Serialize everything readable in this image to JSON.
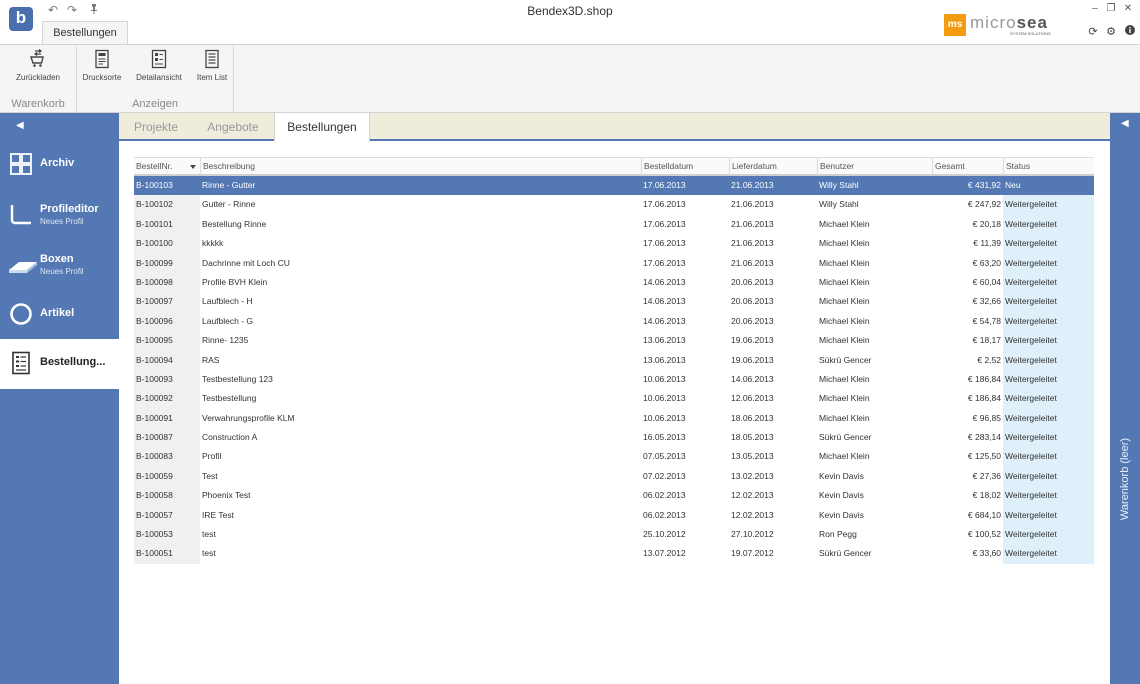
{
  "window": {
    "title": "Bendex3D.shop",
    "logo_letter": "b"
  },
  "quick_access": {
    "undo_icon": "undo-icon",
    "redo_icon": "redo-icon",
    "pin_icon": "pin-icon"
  },
  "ribbon": {
    "active_tab": "Bestellungen",
    "groups": [
      {
        "label": "Warenkorb",
        "buttons": [
          {
            "label": "Zurückladen",
            "icon": "cart-reload-icon"
          }
        ]
      },
      {
        "label": "Anzeigen",
        "buttons": [
          {
            "label": "Drucksorte",
            "icon": "print-document-icon"
          },
          {
            "label": "Detailansicht",
            "icon": "detail-view-icon"
          },
          {
            "label": "Item List",
            "icon": "item-list-icon"
          }
        ]
      }
    ]
  },
  "brand": {
    "mark": "ms",
    "word_light": "micro",
    "word_bold": "sea",
    "tagline": "SYSTEM SOLUTIONS"
  },
  "window_controls": {
    "minimize": "–",
    "restore": "❐",
    "close": "✕"
  },
  "system_icons": [
    "refresh-icon",
    "settings-icon",
    "info-icon"
  ],
  "sidebar": {
    "collapse_glyph": "◀",
    "items": [
      {
        "title": "Archiv",
        "subtitle": "",
        "icon": "archive-grid-icon",
        "active": false
      },
      {
        "title": "Profileditor",
        "subtitle": "Neues Profil",
        "icon": "profile-editor-icon",
        "active": false
      },
      {
        "title": "Boxen",
        "subtitle": "Neues Profil",
        "icon": "box-icon",
        "active": false
      },
      {
        "title": "Artikel",
        "subtitle": "",
        "icon": "article-circle-icon",
        "active": false
      },
      {
        "title": "Bestellung...",
        "subtitle": "",
        "icon": "orders-icon",
        "active": true
      }
    ]
  },
  "right_panel": {
    "expand_glyph": "◀",
    "label": "Warenkorb (leer)"
  },
  "tabs": [
    {
      "label": "Projekte",
      "active": false
    },
    {
      "label": "Angebote",
      "active": false
    },
    {
      "label": "Bestellungen",
      "active": true
    }
  ],
  "table": {
    "columns": [
      "BestellNr.",
      "Beschreibung",
      "Bestelldatum",
      "Lieferdatum",
      "Benutzer",
      "Gesamt",
      "Status"
    ],
    "sorted_column": "BestellNr.",
    "sort_direction": "descending",
    "selected_row": 0,
    "rows": [
      [
        "B-100103",
        "Rinne - Gutter",
        "17.06.2013",
        "21.06.2013",
        "Willy Stahl",
        "€ 431,92",
        "Neu"
      ],
      [
        "B-100102",
        "Gutter - Rinne",
        "17.06.2013",
        "21.06.2013",
        "Willy Stahl",
        "€ 247,92",
        "Weitergeleitet"
      ],
      [
        "B-100101",
        "Bestellung Rinne",
        "17.06.2013",
        "21.06.2013",
        "Michael Klein",
        "€ 20,18",
        "Weitergeleitet"
      ],
      [
        "B-100100",
        "kkkkk",
        "17.06.2013",
        "21.06.2013",
        "Michael Klein",
        "€ 11,39",
        "Weitergeleitet"
      ],
      [
        "B-100099",
        "Dachrinne mit Loch CU",
        "17.06.2013",
        "21.06.2013",
        "Michael Klein",
        "€ 63,20",
        "Weitergeleitet"
      ],
      [
        "B-100098",
        "Profile BVH  Klein",
        "14.06.2013",
        "20.06.2013",
        "Michael Klein",
        "€ 60,04",
        "Weitergeleitet"
      ],
      [
        "B-100097",
        "Laufblech - H",
        "14.06.2013",
        "20.06.2013",
        "Michael Klein",
        "€ 32,66",
        "Weitergeleitet"
      ],
      [
        "B-100096",
        "Laufblech - G",
        "14.06.2013",
        "20.06.2013",
        "Michael Klein",
        "€ 54,78",
        "Weitergeleitet"
      ],
      [
        "B-100095",
        "Rinne- 1235",
        "13.06.2013",
        "19.06.2013",
        "Michael Klein",
        "€ 18,17",
        "Weitergeleitet"
      ],
      [
        "B-100094",
        "RAS",
        "13.06.2013",
        "19.06.2013",
        "Sükrü  Gencer",
        "€ 2,52",
        "Weitergeleitet"
      ],
      [
        "B-100093",
        "Testbestellung 123",
        "10.06.2013",
        "14.06.2013",
        "Michael Klein",
        "€ 186,84",
        "Weitergeleitet"
      ],
      [
        "B-100092",
        "Testbestellung",
        "10.06.2013",
        "12.06.2013",
        "Michael Klein",
        "€ 186,84",
        "Weitergeleitet"
      ],
      [
        "B-100091",
        "Verwahrungsprofile KLM",
        "10.06.2013",
        "18.06.2013",
        "Michael Klein",
        "€ 96,85",
        "Weitergeleitet"
      ],
      [
        "B-100087",
        "Construction A",
        "16.05.2013",
        "18.05.2013",
        "Sükrü  Gencer",
        "€ 283,14",
        "Weitergeleitet"
      ],
      [
        "B-100083",
        "Profil",
        "07.05.2013",
        "13.05.2013",
        "Michael Klein",
        "€ 125,50",
        "Weitergeleitet"
      ],
      [
        "B-100059",
        "Test",
        "07.02.2013",
        "13.02.2013",
        "Kevin Davis",
        "€ 27,36",
        "Weitergeleitet"
      ],
      [
        "B-100058",
        "Phoenix Test",
        "06.02.2013",
        "12.02.2013",
        "Kevin Davis",
        "€ 18,02",
        "Weitergeleitet"
      ],
      [
        "B-100057",
        "IRE Test",
        "06.02.2013",
        "12.02.2013",
        "Kevin Davis",
        "€ 684,10",
        "Weitergeleitet"
      ],
      [
        "B-100053",
        "test",
        "25.10.2012",
        "27.10.2012",
        "Ron Pegg",
        "€ 100,52",
        "Weitergeleitet"
      ],
      [
        "B-100051",
        "test",
        "13.07.2012",
        "19.07.2012",
        "Sükrü  Gencer",
        "€ 33,60",
        "Weitergeleitet"
      ]
    ]
  }
}
